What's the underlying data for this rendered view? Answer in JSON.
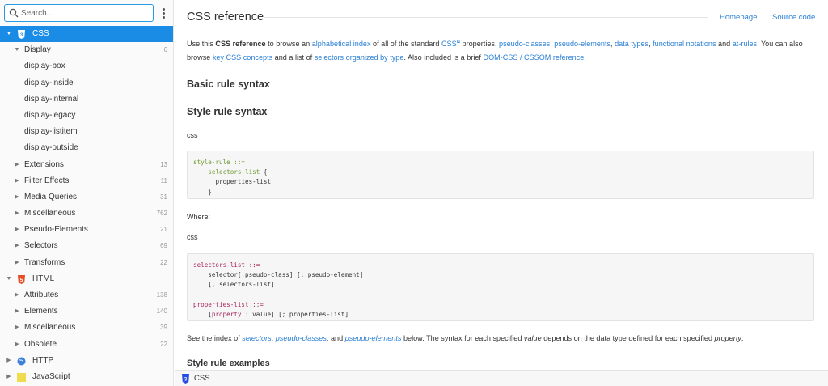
{
  "search": {
    "placeholder": "Search..."
  },
  "tree": {
    "css": {
      "label": "CSS"
    },
    "display": {
      "label": "Display",
      "count": "6"
    },
    "display_children": [
      "display-box",
      "display-inside",
      "display-internal",
      "display-legacy",
      "display-listitem",
      "display-outside"
    ],
    "css_groups": [
      {
        "label": "Extensions",
        "count": "13"
      },
      {
        "label": "Filter Effects",
        "count": "11"
      },
      {
        "label": "Media Queries",
        "count": "31"
      },
      {
        "label": "Miscellaneous",
        "count": "762"
      },
      {
        "label": "Pseudo-Elements",
        "count": "21"
      },
      {
        "label": "Selectors",
        "count": "69"
      },
      {
        "label": "Transforms",
        "count": "22"
      }
    ],
    "html": {
      "label": "HTML"
    },
    "html_groups": [
      {
        "label": "Attributes",
        "count": "138"
      },
      {
        "label": "Elements",
        "count": "140"
      },
      {
        "label": "Miscellaneous",
        "count": "39"
      },
      {
        "label": "Obsolete",
        "count": "22"
      }
    ],
    "http": {
      "label": "HTTP"
    },
    "next": {
      "label": "JavaScript"
    }
  },
  "main": {
    "title": "CSS reference",
    "homepage_link": "Homepage",
    "source_link": "Source code",
    "intro": {
      "t1": "Use this ",
      "b1": "CSS reference",
      "t2": " to browse an ",
      "l1": "alphabetical index",
      "t3": " of all of the standard ",
      "l2": "CSS",
      "t4": " properties, ",
      "l3": "pseudo-classes",
      "t5": ", ",
      "l4": "pseudo-elements",
      "t6": ", ",
      "l5": "data types",
      "t7": ", ",
      "l6": "functional notations",
      "t8": " and ",
      "l7": "at-rules",
      "t9": ". You can also",
      "t10": "browse ",
      "l8": "key CSS concepts",
      "t11": " and a list of ",
      "l9": "selectors organized by type",
      "t12": ". Also included is a brief ",
      "l10": "DOM-CSS / CSSOM reference",
      "t13": "."
    },
    "h_basic": "Basic rule syntax",
    "h_style": "Style rule syntax",
    "lang1": "css",
    "code1": {
      "l1": "style-rule ::=",
      "l2a": "    ",
      "l2b": "selectors-list",
      "l2c": " {",
      "l3a": "      ",
      "l3b": "properties-list",
      "l4": "    }"
    },
    "where": "Where:",
    "lang2": "css",
    "code2": {
      "a1": "selectors-list ::=",
      "a2": "    selector[:pseudo-class] [::pseudo-element]",
      "a3": "    [, selectors-list]",
      "b1": "properties-list ::=",
      "b2a": "    [",
      "b2b": "property",
      "b2c": " : value] [; properties-list]"
    },
    "see": {
      "t1": "See the index of ",
      "l1": "selectors",
      "t2": ", ",
      "l2": "pseudo-classes",
      "t3": ", and ",
      "l3": "pseudo-elements",
      "t4": " below. The syntax for each specified ",
      "e1": "value",
      "t5": " depends on the data type defined for each specified ",
      "e2": "property",
      "t6": "."
    },
    "h_examples": "Style rule examples"
  },
  "statusbar": {
    "label": "CSS"
  },
  "colors": {
    "accent": "#1a8ce6",
    "link": "#2a7fd4",
    "html_badge": "#e44d26",
    "css_badge": "#264de4"
  }
}
